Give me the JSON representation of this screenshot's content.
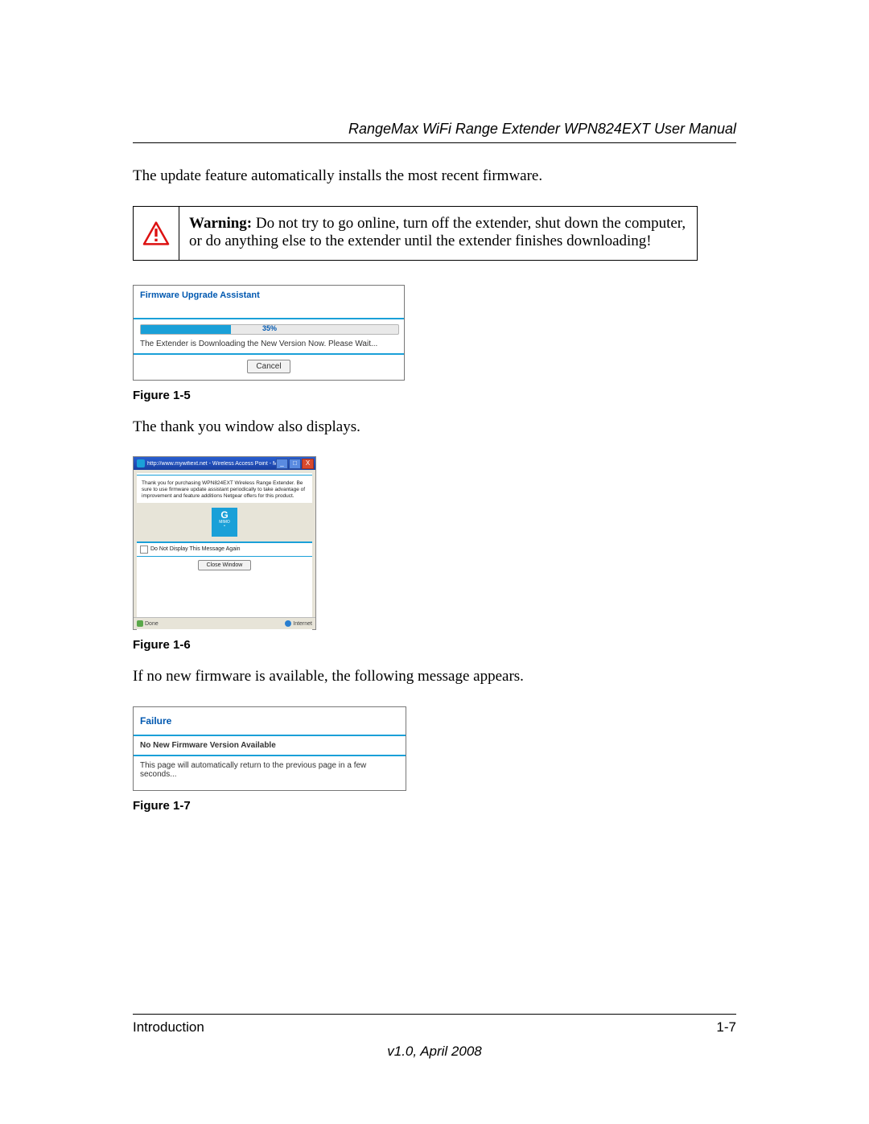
{
  "header": {
    "running_title": "RangeMax WiFi Range Extender WPN824EXT User Manual"
  },
  "paragraphs": {
    "p1": "The update feature automatically installs the most recent firmware.",
    "p2": "The thank you window also displays.",
    "p3": "If no new firmware is available, the following message appears."
  },
  "warning": {
    "label": "Warning:",
    "text": " Do not try to go online, turn off the extender, shut down the computer, or do anything else to the extender until the extender finishes downloading!"
  },
  "figures": {
    "f5": {
      "caption": "Figure 1-5",
      "title": "Firmware Upgrade Assistant",
      "percent_label": "35%",
      "percent_width": "35%",
      "message": "The Extender is Downloading the New Version Now. Please Wait...",
      "cancel": "Cancel"
    },
    "f6": {
      "caption": "Figure 1-6",
      "titlebar": "http://www.mywifiext.net - Wireless Access Point - Micro...",
      "min": "_",
      "max": "□",
      "close": "X",
      "thankyou": "Thank you for purchasing WPN824EXT Wireless Range Extender. Be sure to use firmware update assistant periodically to take advantage of improvement and feature additions Netgear offers for this product.",
      "logo_main": "G",
      "logo_sub1": "MIMO",
      "logo_sub2": "•",
      "checkbox_label": "Do Not Display This Message Again",
      "close_window": "Close Window",
      "status_done": "Done",
      "status_internet": "Internet"
    },
    "f7": {
      "caption": "Figure 1-7",
      "title": "Failure",
      "sub": "No New Firmware Version Available",
      "message": "This page will automatically return to the previous page in a few seconds..."
    }
  },
  "footer": {
    "section": "Introduction",
    "page": "1-7",
    "version": "v1.0, April 2008"
  }
}
